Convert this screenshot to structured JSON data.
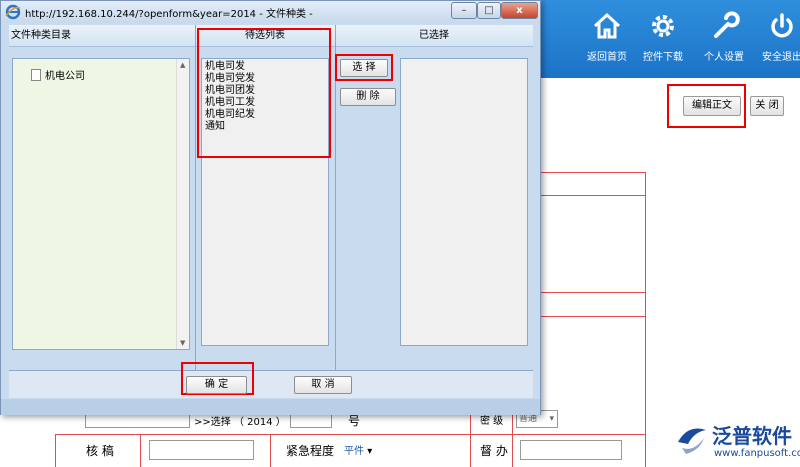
{
  "dialog": {
    "title": "http://192.168.10.244/?openform&year=2014 - 文件种类 -",
    "window_controls": {
      "minimize": "–",
      "maximize": "□",
      "close": "x"
    },
    "columns": {
      "catalog": "文件种类目录",
      "candidates": "待选列表",
      "selected": "已选择"
    },
    "tree": [
      {
        "label": "机电公司"
      }
    ],
    "candidate_items": [
      "机电司发",
      "机电司党发",
      "机电司团发",
      "机电司工发",
      "机电司纪发",
      "通知"
    ],
    "selected_items": [],
    "buttons": {
      "select": "选 择",
      "delete": "删 除",
      "ok": "确 定",
      "cancel": "取 消"
    }
  },
  "app": {
    "nav": [
      {
        "label": "返回首页",
        "icon": "home-icon"
      },
      {
        "label": "控件下载",
        "icon": "gear-icon"
      },
      {
        "label": "个人设置",
        "icon": "wrench-icon"
      },
      {
        "label": "安全退出",
        "icon": "power-icon"
      }
    ],
    "toolbar": {
      "edit_body": "编辑正文",
      "close": "关 闭"
    },
    "form": {
      "select_suffix": ">>选择 （ 2014 ）",
      "number_label": "号",
      "level_label": "密 级",
      "level_value": "普通",
      "review_label": "核 稿",
      "urgency_label": "紧急程度",
      "urgency_value": "平件",
      "supervise_label": "督 办"
    }
  },
  "watermark": {
    "brand": "泛普软件",
    "url": "www.fanpusoft.com"
  },
  "colors": {
    "highlight": "#e00000",
    "topbar": "#1f7ccf",
    "dialog_bg": "#c9dcef"
  }
}
